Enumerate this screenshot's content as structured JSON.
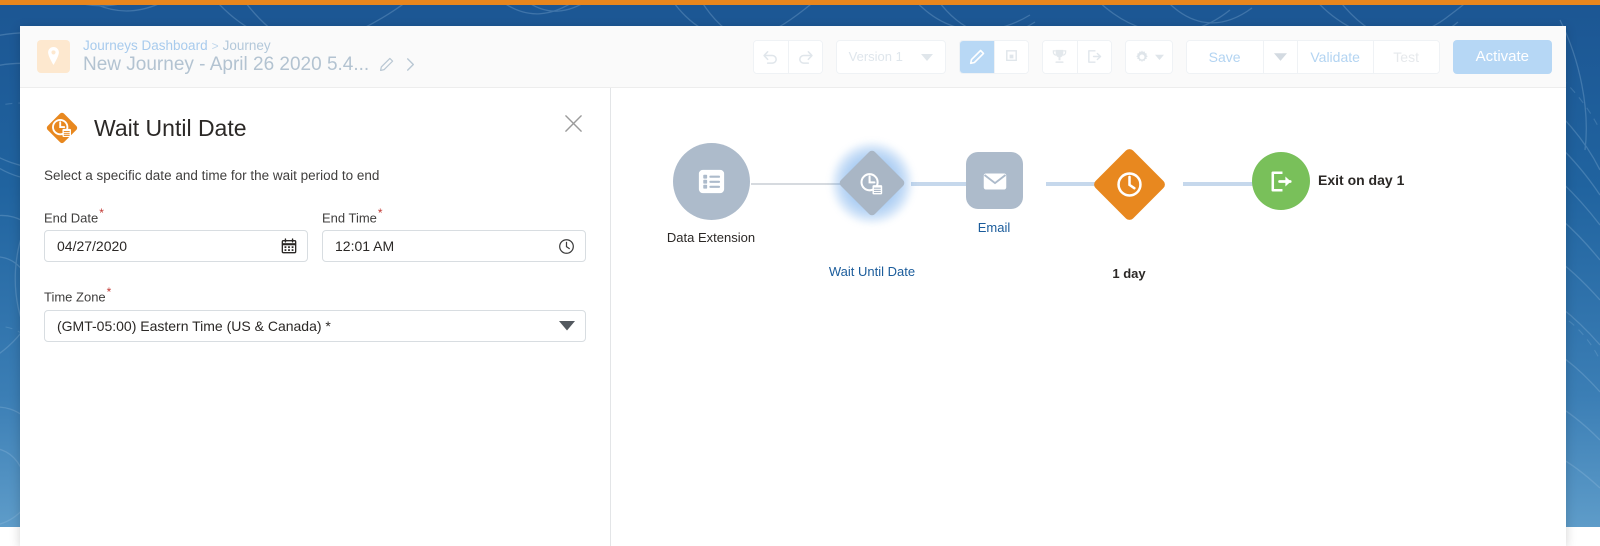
{
  "theme": {
    "accent_orange": "#e8861e",
    "brand_blue": "#1c5693",
    "node_gray": "#adbbcb",
    "node_green": "#79c05a",
    "selected_glow": "#2d82e1",
    "required_red": "#c23934"
  },
  "header": {
    "location_icon": "map-pin-icon",
    "breadcrumb": {
      "root": "Journeys Dashboard",
      "separator": ">",
      "current": "Journey"
    },
    "journey_title": "New Journey - April 26 2020 5.4...",
    "edit_icon": "pencil-icon",
    "expand_icon": "chevron-right-icon",
    "toolbar": {
      "undo_icon": "undo-icon",
      "redo_icon": "redo-icon",
      "version_label": "Version 1",
      "version_caret": "caret-down-icon",
      "edit_mode_icon": "pencil-icon",
      "copy_mode_icon": "layers-icon",
      "goals_icon": "trophy-icon",
      "exit_icon": "exit-arrow-icon",
      "settings_icon": "gear-icon",
      "settings_caret": "caret-down-icon",
      "save_label": "Save",
      "save_caret": "caret-down-icon",
      "validate_label": "Validate",
      "test_label": "Test",
      "activate_label": "Activate"
    }
  },
  "panel": {
    "icon": "wait-until-date-icon",
    "title": "Wait Until Date",
    "close_icon": "close-icon",
    "description": "Select a specific date and time for the wait period to end",
    "fields": [
      {
        "label": "End Date",
        "required": "*",
        "value": "04/27/2020",
        "icon": "calendar-icon"
      },
      {
        "label": "End Time",
        "required": "*",
        "value": "12:01 AM",
        "icon": "clock-icon"
      },
      {
        "label": "Time Zone",
        "required": "*",
        "value": "(GMT-05:00) Eastern Time (US & Canada) *",
        "icon": "caret-down-icon"
      }
    ]
  },
  "canvas": {
    "nodes": [
      {
        "id": "data-extension",
        "label": "Data Extension",
        "icon": "list-icon",
        "shape": "circle",
        "color": "#adbbcb",
        "label_style": "dark"
      },
      {
        "id": "wait-until-date",
        "label": "Wait Until Date",
        "icon": "wait-until-date-icon",
        "shape": "diamond",
        "color": "#a9b6c5",
        "label_style": "blue",
        "selected": true
      },
      {
        "id": "email",
        "label": "Email",
        "icon": "envelope-icon",
        "shape": "square",
        "color": "#adbbcb",
        "label_style": "blue"
      },
      {
        "id": "wait-1-day",
        "label": "1 day",
        "icon": "clock-icon",
        "shape": "diamond",
        "color": "#e8881f",
        "label_style": "dark"
      },
      {
        "id": "exit",
        "label": "Exit on day 1",
        "icon": "exit-arrow-icon",
        "shape": "circle",
        "color": "#79c05a",
        "label_style": "dark"
      }
    ]
  }
}
